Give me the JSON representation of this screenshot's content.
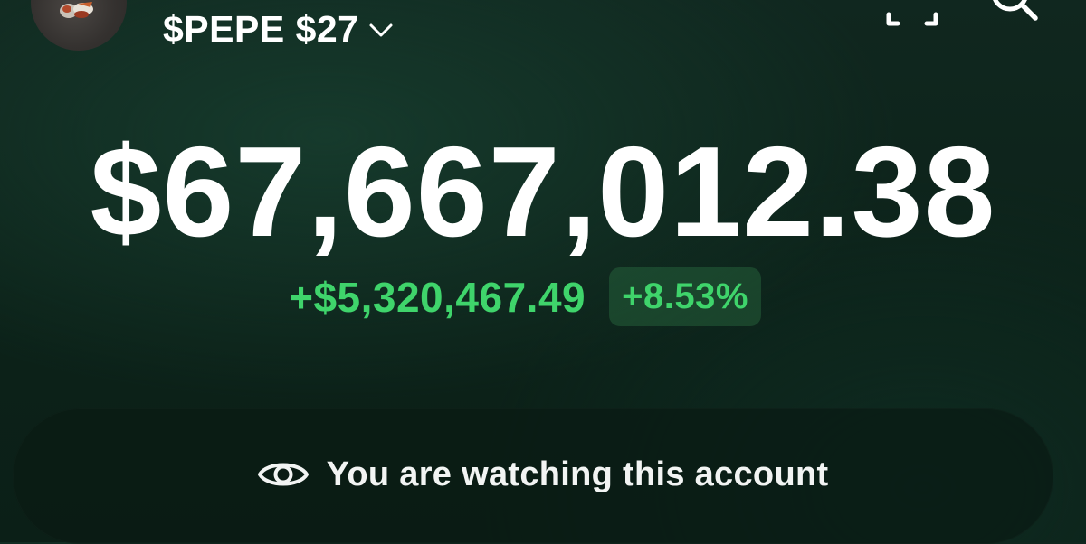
{
  "header": {
    "account_name": "$PEPE $27",
    "icons": {
      "avatar": "pepe-frog-avatar",
      "switcher": "chevron-down-icon",
      "scan": "scan-icon",
      "search": "search-icon"
    }
  },
  "balance": {
    "total": "$67,667,012.38",
    "change_amount": "+$5,320,467.49",
    "change_percent": "+8.53%"
  },
  "banner": {
    "text": "You are watching this account",
    "icon": "eye-icon"
  },
  "colors": {
    "background": "#0c2219",
    "positive": "#3fd46b",
    "text": "#ffffff"
  }
}
